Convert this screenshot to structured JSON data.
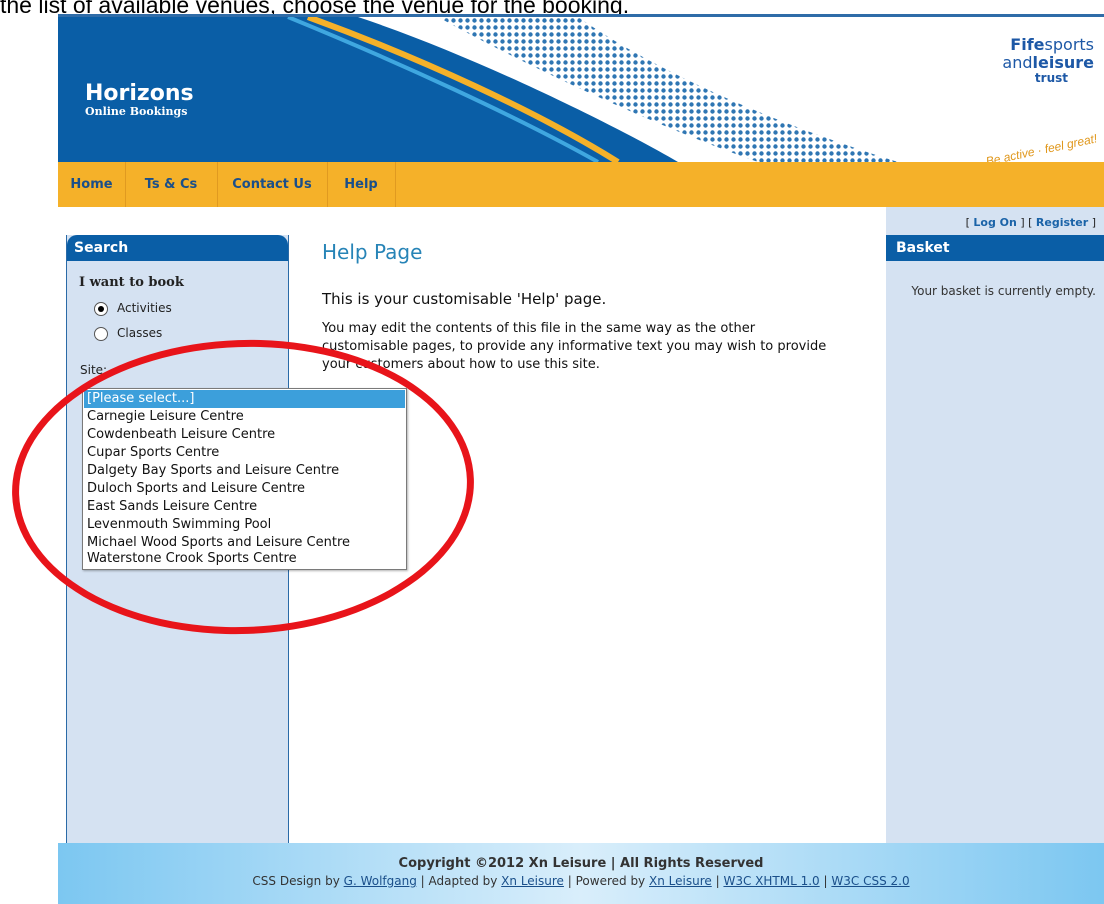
{
  "instruction": "the list of available venues, choose the venue for the booking.",
  "header": {
    "title": "Horizons",
    "subtitle": "Online Bookings",
    "logo": {
      "line1_bold": "Fife",
      "line1_rest": "sports",
      "line2_pre": "and",
      "line2_bold": "leisure",
      "line3": "trust",
      "tagline": "Be active · feel great!"
    }
  },
  "nav": {
    "items": [
      {
        "label": "Home"
      },
      {
        "label": "Ts & Cs"
      },
      {
        "label": "Contact Us"
      },
      {
        "label": "Help"
      }
    ]
  },
  "sidebar": {
    "title": "Search",
    "want_label": "I want to book",
    "radio_activities": "Activities",
    "radio_classes": "Classes",
    "selected_radio": "Activities",
    "site_label": "Site:",
    "dropdown": {
      "options": [
        "[Please select...]",
        "Carnegie Leisure Centre",
        "Cowdenbeath Leisure Centre",
        "Cupar Sports Centre",
        "Dalgety Bay Sports and Leisure Centre",
        "Duloch Sports and Leisure Centre",
        "East Sands Leisure Centre",
        "Levenmouth Swimming Pool",
        "Michael Wood Sports and Leisure Centre",
        "Waterstone Crook Sports Centre"
      ],
      "highlighted": "[Please select...]"
    }
  },
  "main": {
    "title": "Help Page",
    "subtitle": "This is your customisable 'Help' page.",
    "paragraph": "You may edit the contents of this file in the same way as the other customisable pages, to provide any informative text you may wish to provide your customers about how to use this site."
  },
  "right": {
    "bracket_open": "[",
    "logon": "Log On",
    "bracket_mid": "] [",
    "register": "Register",
    "bracket_close": "]",
    "basket_title": "Basket",
    "basket_empty": "Your basket is currently empty."
  },
  "footer": {
    "copyright": "Copyright ©2012 Xn Leisure | All Rights Reserved",
    "css_design_by": "CSS Design by",
    "designer": "G. Wolfgang",
    "adapted_by": "| Adapted by",
    "adapter": "Xn Leisure",
    "powered_by": "| Powered by",
    "powerer": "Xn Leisure",
    "sep": "|",
    "xhtml": "W3C XHTML 1.0",
    "sep2": "|",
    "css": "W3C CSS 2.0"
  },
  "colors": {
    "header_blue": "#0a5ea6",
    "nav_orange": "#f5b129",
    "panel_blue": "#d5e2f2",
    "title_blue": "#2784b7",
    "highlight": "#e8141a"
  }
}
